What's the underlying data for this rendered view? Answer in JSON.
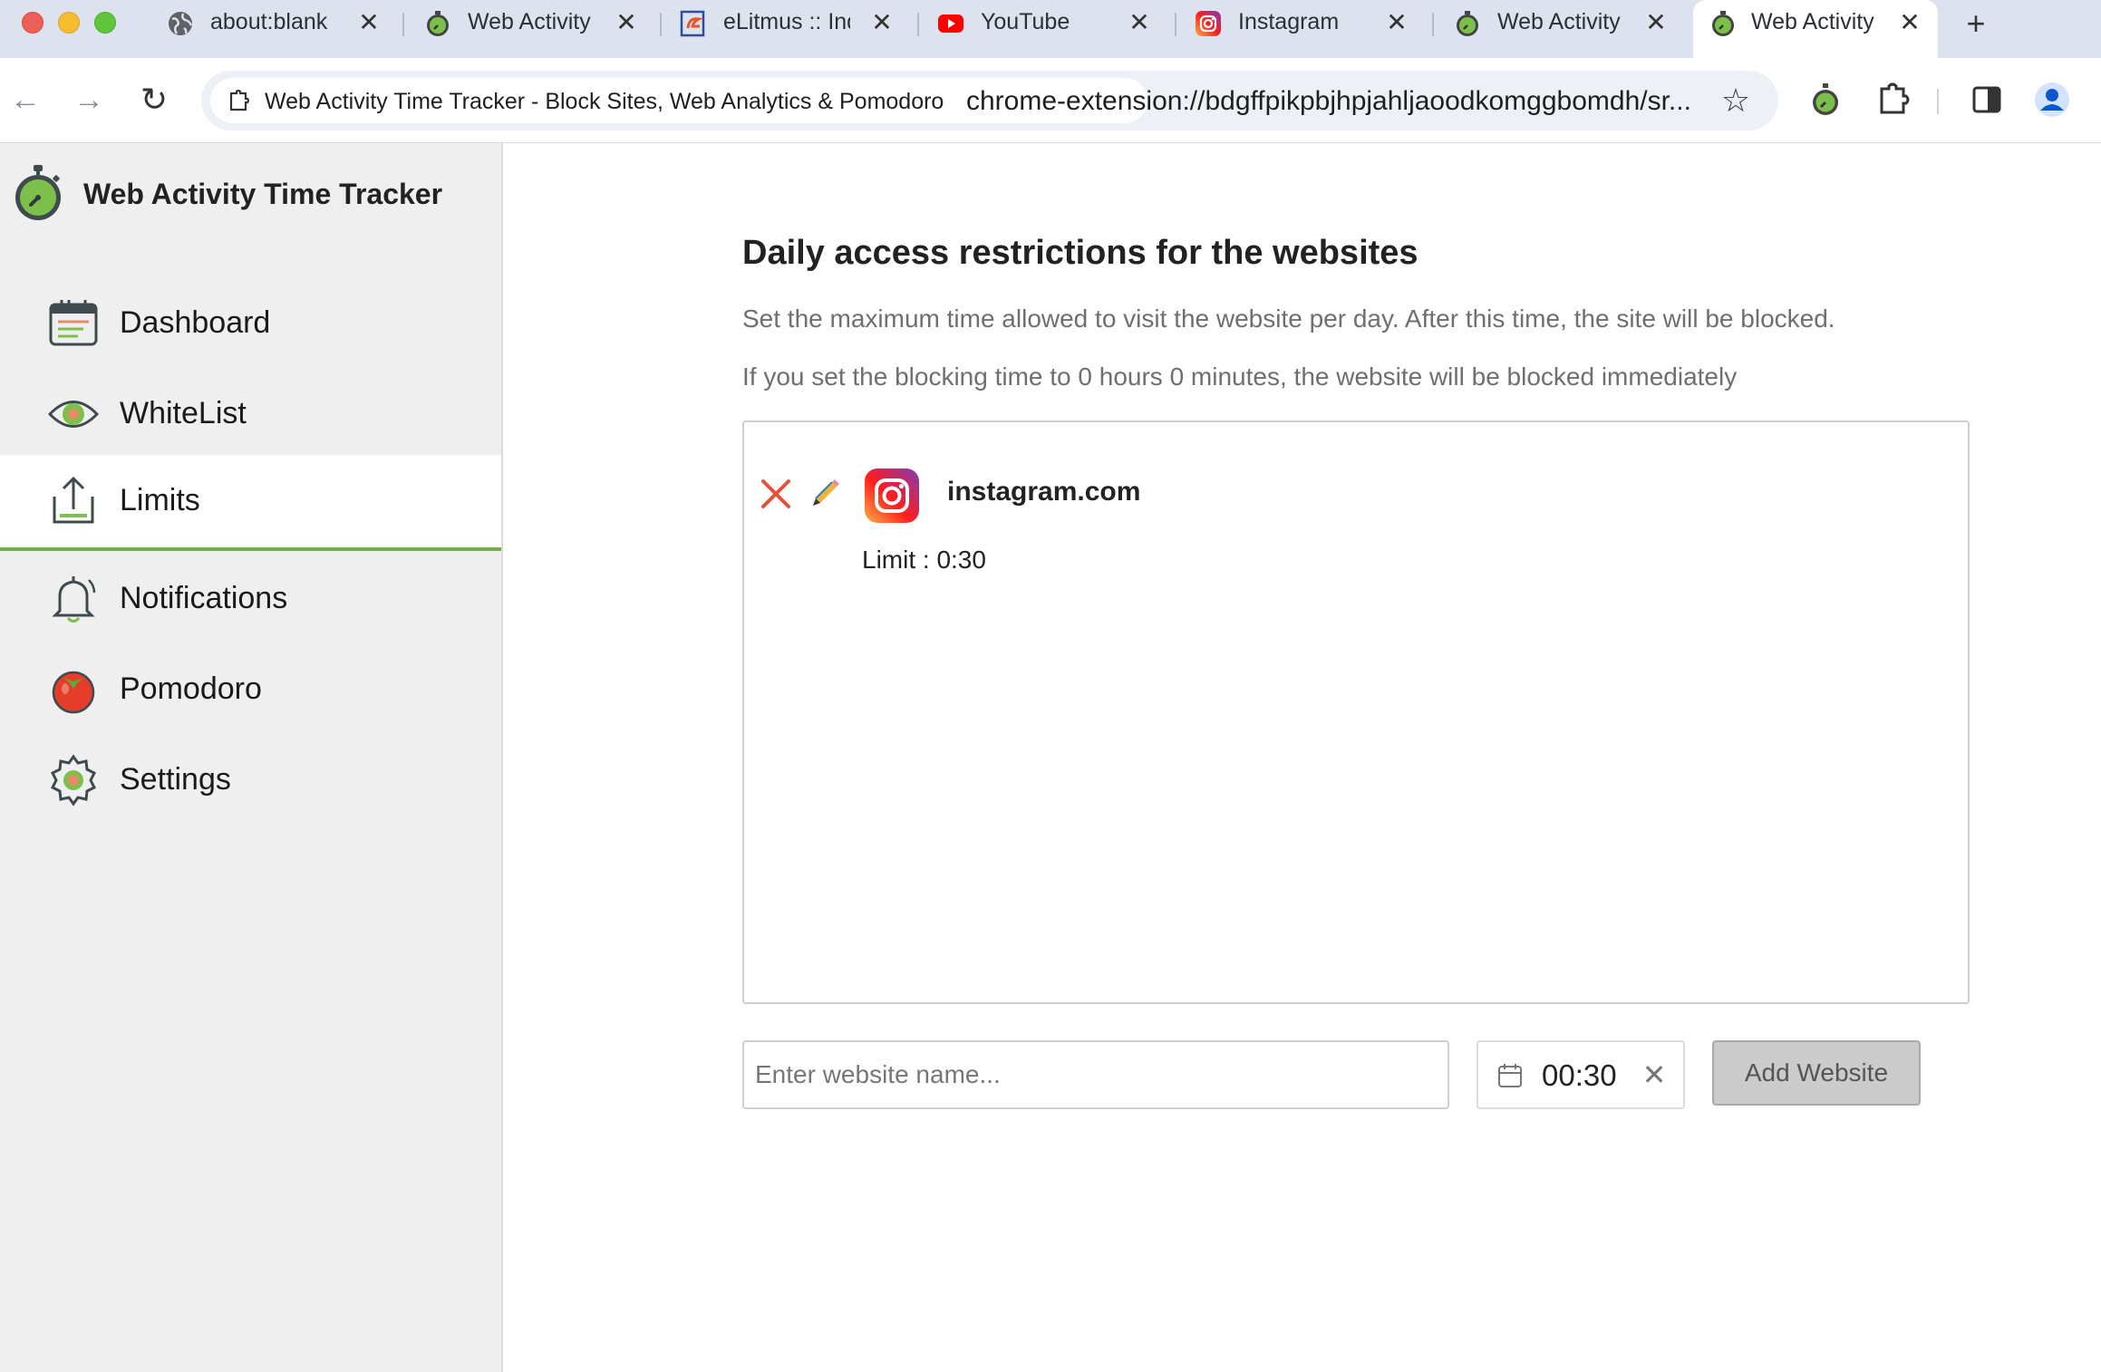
{
  "browser": {
    "tabs": [
      {
        "title": "about:blank",
        "icon": "globe-icon"
      },
      {
        "title": "Web Activity Time Tracker",
        "icon": "stopwatch-icon"
      },
      {
        "title": "eLitmus :: India",
        "icon": "elitmus-icon"
      },
      {
        "title": "YouTube",
        "icon": "youtube-icon"
      },
      {
        "title": "Instagram",
        "icon": "instagram-icon"
      },
      {
        "title": "Web Activity Time Tracker",
        "icon": "stopwatch-icon"
      },
      {
        "title": "Web Activity Time Tracker",
        "icon": "stopwatch-icon",
        "active": true
      }
    ],
    "tab_close_glyph": "✕",
    "new_tab_glyph": "+",
    "back_glyph": "←",
    "forward_glyph": "→",
    "reload_glyph": "↻",
    "star_glyph": "☆",
    "chip_title": "Web Activity Time Tracker - Block Sites, Web Analytics & Pomodoro",
    "url": "chrome-extension://bdgffpikpbjhpjahljaoodkomggbomdh/sr..."
  },
  "app": {
    "name": "Web Activity Time Tracker",
    "accent_color": "#71b046"
  },
  "sidebar": {
    "items": [
      {
        "label": "Dashboard",
        "icon": "dashboard-calendar-icon"
      },
      {
        "label": "WhiteList",
        "icon": "eye-icon"
      },
      {
        "label": "Limits",
        "icon": "upload-tray-icon",
        "active": true
      },
      {
        "label": "Notifications",
        "icon": "bell-icon"
      },
      {
        "label": "Pomodoro",
        "icon": "tomato-icon"
      },
      {
        "label": "Settings",
        "icon": "gear-icon"
      }
    ]
  },
  "main": {
    "title": "Daily access restrictions for the websites",
    "description_1": "Set the maximum time allowed to visit the website per day. After this time, the site will be blocked.",
    "description_2": "If you set the blocking time to 0 hours 0 minutes, the website will be blocked immediately",
    "limits": [
      {
        "site": "instagram.com",
        "limit_text": "Limit : 0:30",
        "icon": "instagram-icon"
      }
    ],
    "input_placeholder": "Enter website name...",
    "time_value": "00:30",
    "time_clear_glyph": "✕",
    "add_button": "Add Website"
  }
}
